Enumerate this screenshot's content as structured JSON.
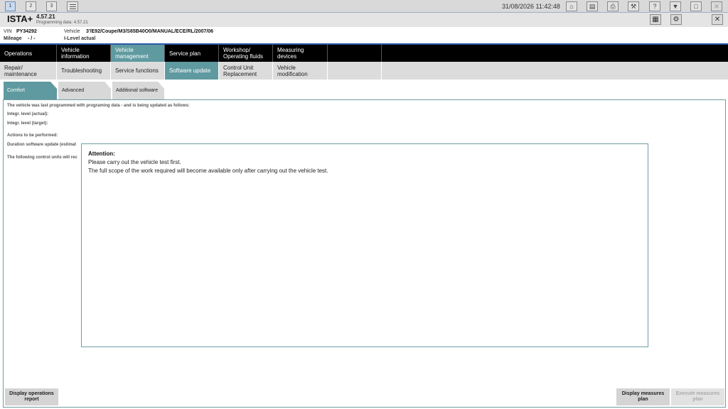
{
  "topbar": {
    "sessions": [
      "1",
      "2",
      "3"
    ],
    "datetime": "31/08/2026 11:42:48",
    "icons": [
      "home-icon",
      "book-icon",
      "printer-icon",
      "wrench-icon",
      "help-icon",
      "minimize-icon",
      "restore-icon",
      "close-icon"
    ]
  },
  "header": {
    "app_title": "ISTA+",
    "version": "4.57.21",
    "programming_label": "Programming data:  4.57.21",
    "icons": [
      "document-icon",
      "gear-icon",
      "close-icon"
    ]
  },
  "vehicle": {
    "vin_label": "VIN",
    "vin_value": "PY34292",
    "vehicle_label": "Vehicle",
    "vehicle_value": "3'/E92/Coupe/M3/S65B40O0/MANUAL/ECE/RL/2007/06",
    "mileage_label": "Mileage",
    "mileage_value": "- / -",
    "ilevel_label": "I-Level actual"
  },
  "nav1": [
    {
      "label": "Operations",
      "active": false
    },
    {
      "label": "Vehicle information",
      "active": false
    },
    {
      "label": "Vehicle management",
      "active": true
    },
    {
      "label": "Service plan",
      "active": false
    },
    {
      "label": "Workshop/ Operating fluids",
      "active": false
    },
    {
      "label": "Measuring devices",
      "active": false
    }
  ],
  "nav2": [
    {
      "label": "Repair/ maintenance",
      "active": false
    },
    {
      "label": "Troubleshooting",
      "active": false
    },
    {
      "label": "Service functions",
      "active": false
    },
    {
      "label": "Software update",
      "active": true
    },
    {
      "label": "Control Unit Replacement",
      "active": false
    },
    {
      "label": "Vehicle modification",
      "active": false
    }
  ],
  "tabs": [
    {
      "label": "Comfort",
      "active": true
    },
    {
      "label": "Advanced",
      "active": false
    },
    {
      "label": "Additional software",
      "active": false
    }
  ],
  "content": {
    "line1": "The vehicle was last programmed with programing data - and is being updated as follows:",
    "line2": "Integr. level (actual):",
    "line3": "Integr. level (target):",
    "line4": "Actions to be performed:",
    "line5": "Duration software update (estimat",
    "line6": "The following control units will rec"
  },
  "dialog": {
    "title": "Attention:",
    "line1": "Please carry out the vehicle test first.",
    "line2": "The full scope of the work required will become available only after carrying out the vehicle test."
  },
  "footer": {
    "display_report": "Display operations report",
    "display_plan": "Display measures plan",
    "execute_plan": "Execute measures plan"
  }
}
